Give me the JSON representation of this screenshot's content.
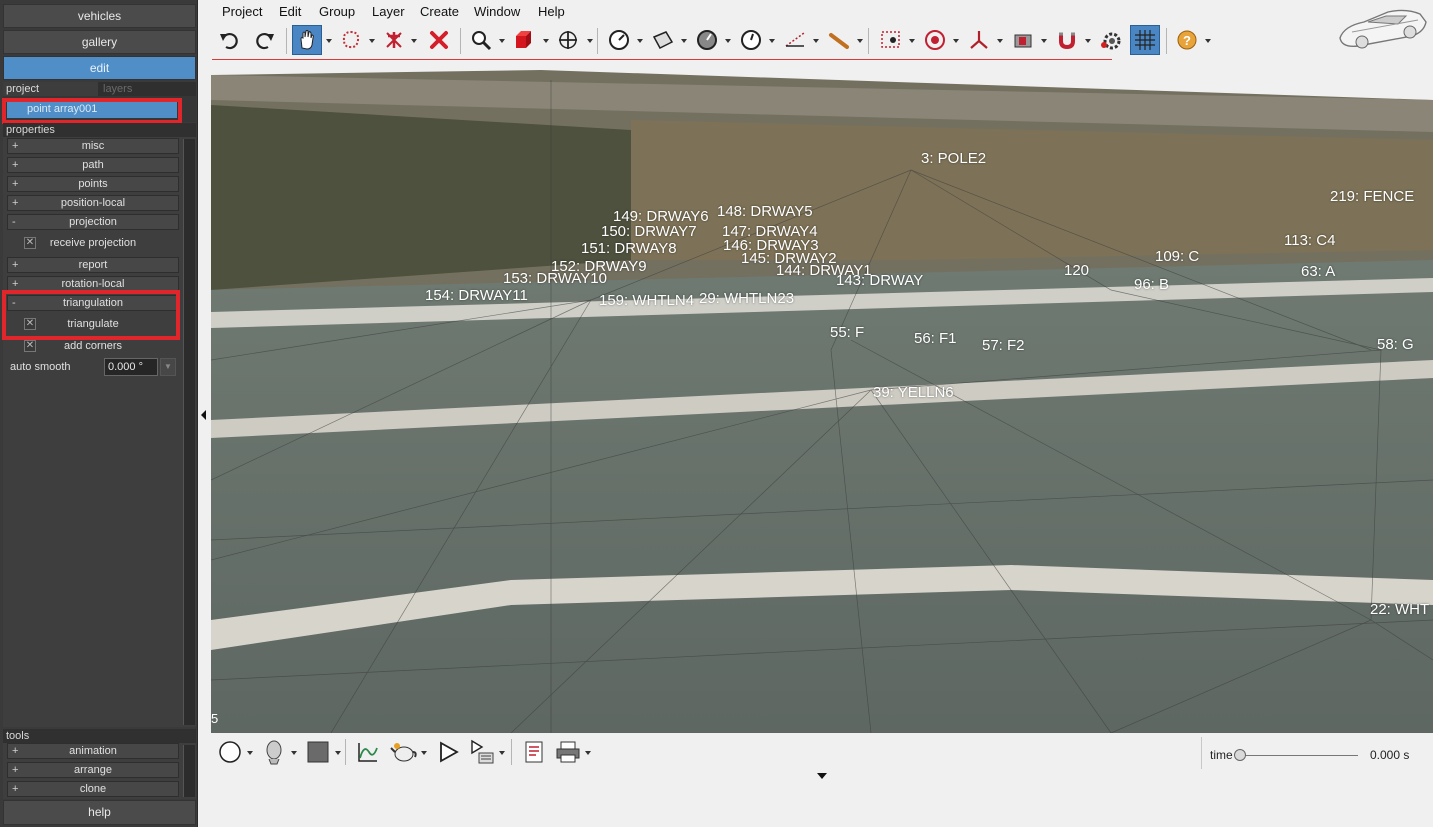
{
  "left_panel": {
    "nav": {
      "vehicles": "vehicles",
      "gallery": "gallery",
      "edit": "edit"
    },
    "tabs": {
      "project": "project",
      "layers": "layers"
    },
    "project_item": "point array001",
    "properties_header": "properties",
    "sections": {
      "misc": "misc",
      "path": "path",
      "points": "points",
      "position_local": "position-local",
      "projection": "projection",
      "receive_projection": "receive projection",
      "report": "report",
      "rotation_local": "rotation-local",
      "triangulation": "triangulation",
      "triangulate": "triangulate",
      "add_corners": "add corners"
    },
    "plus": "+",
    "minus": "-",
    "check": "✕",
    "auto_smooth_label": "auto smooth",
    "auto_smooth_value": "0.000 °",
    "tools_header": "tools",
    "tools": {
      "animation": "animation",
      "arrange": "arrange",
      "clone": "clone"
    },
    "help": "help",
    "highlight_color": "#e0262b",
    "accent_color": "#4f8ec7"
  },
  "menu": {
    "project": "Project",
    "edit": "Edit",
    "group": "Group",
    "layer": "Layer",
    "create": "Create",
    "window": "Window",
    "help": "Help"
  },
  "toolbar_icons": [
    "undo-icon",
    "redo-icon",
    "pan-hand-icon",
    "lasso-select-icon",
    "pin-remove-icon",
    "delete-x-icon",
    "zoom-icon",
    "red-cube-icon",
    "move-icon",
    "gauge-icon",
    "plane-icon",
    "dial-icon",
    "clock-icon",
    "measure-icon",
    "stick-icon",
    "record-frame-icon",
    "target-icon",
    "axis-icon",
    "camera-icon",
    "magnet-icon",
    "gear-icon",
    "grid-icon",
    "help-icon"
  ],
  "viewport": {
    "corner_number": "5",
    "labels": [
      {
        "text": "3: POLE2"
      },
      {
        "text": "149: DRWAY6"
      },
      {
        "text": "148: DRWAY5"
      },
      {
        "text": "150: DRWAY7"
      },
      {
        "text": "147: DRWAY4"
      },
      {
        "text": "151: DRWAY8"
      },
      {
        "text": "146: DRWAY3"
      },
      {
        "text": "145: DRWAY2"
      },
      {
        "text": "152: DRWAY9"
      },
      {
        "text": "144: DRWAY1"
      },
      {
        "text": "153: DRWAY10"
      },
      {
        "text": "143: DRWAY"
      },
      {
        "text": "154: DRWAY11"
      },
      {
        "text": "159: WHTLN4"
      },
      {
        "text": "29: WHTLN23"
      },
      {
        "text": "55: F"
      },
      {
        "text": "56: F1"
      },
      {
        "text": "57: F2"
      },
      {
        "text": "58: G"
      },
      {
        "text": "39: YELLN6"
      },
      {
        "text": "22: WHT"
      },
      {
        "text": "219: FENCE"
      },
      {
        "text": "113: C4"
      },
      {
        "text": "96: B"
      },
      {
        "text": "63: A"
      },
      {
        "text": "120"
      },
      {
        "text": "109: C"
      }
    ]
  },
  "bottom": {
    "time_label": "time",
    "time_value": "0.000 s",
    "time_position": 0.0
  }
}
